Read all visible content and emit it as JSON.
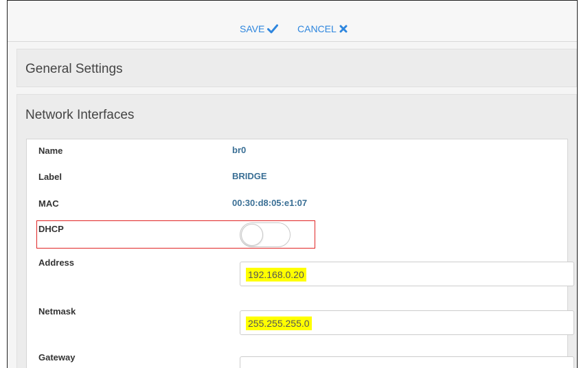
{
  "toolbar": {
    "save_label": "SAVE",
    "save_icon": "check-icon",
    "cancel_label": "CANCEL",
    "cancel_icon": "x-icon",
    "accent_color": "#2e86de"
  },
  "panels": {
    "general_title": "General Settings",
    "network_title": "Network Interfaces"
  },
  "interface": {
    "name_label": "Name",
    "name_value": "br0",
    "label_label": "Label",
    "label_value": "BRIDGE",
    "mac_label": "MAC",
    "mac_value": "00:30:d8:05:e1:07",
    "dhcp_label": "DHCP",
    "dhcp_enabled": false,
    "address_label": "Address",
    "address_value": "192.168.0.20",
    "netmask_label": "Netmask",
    "netmask_value": "255.255.255.0",
    "gateway_label": "Gateway",
    "gateway_value": ""
  },
  "colors": {
    "highlight": "#ffff00",
    "annotation_border": "#e02424",
    "value_text": "#3a6f95"
  }
}
